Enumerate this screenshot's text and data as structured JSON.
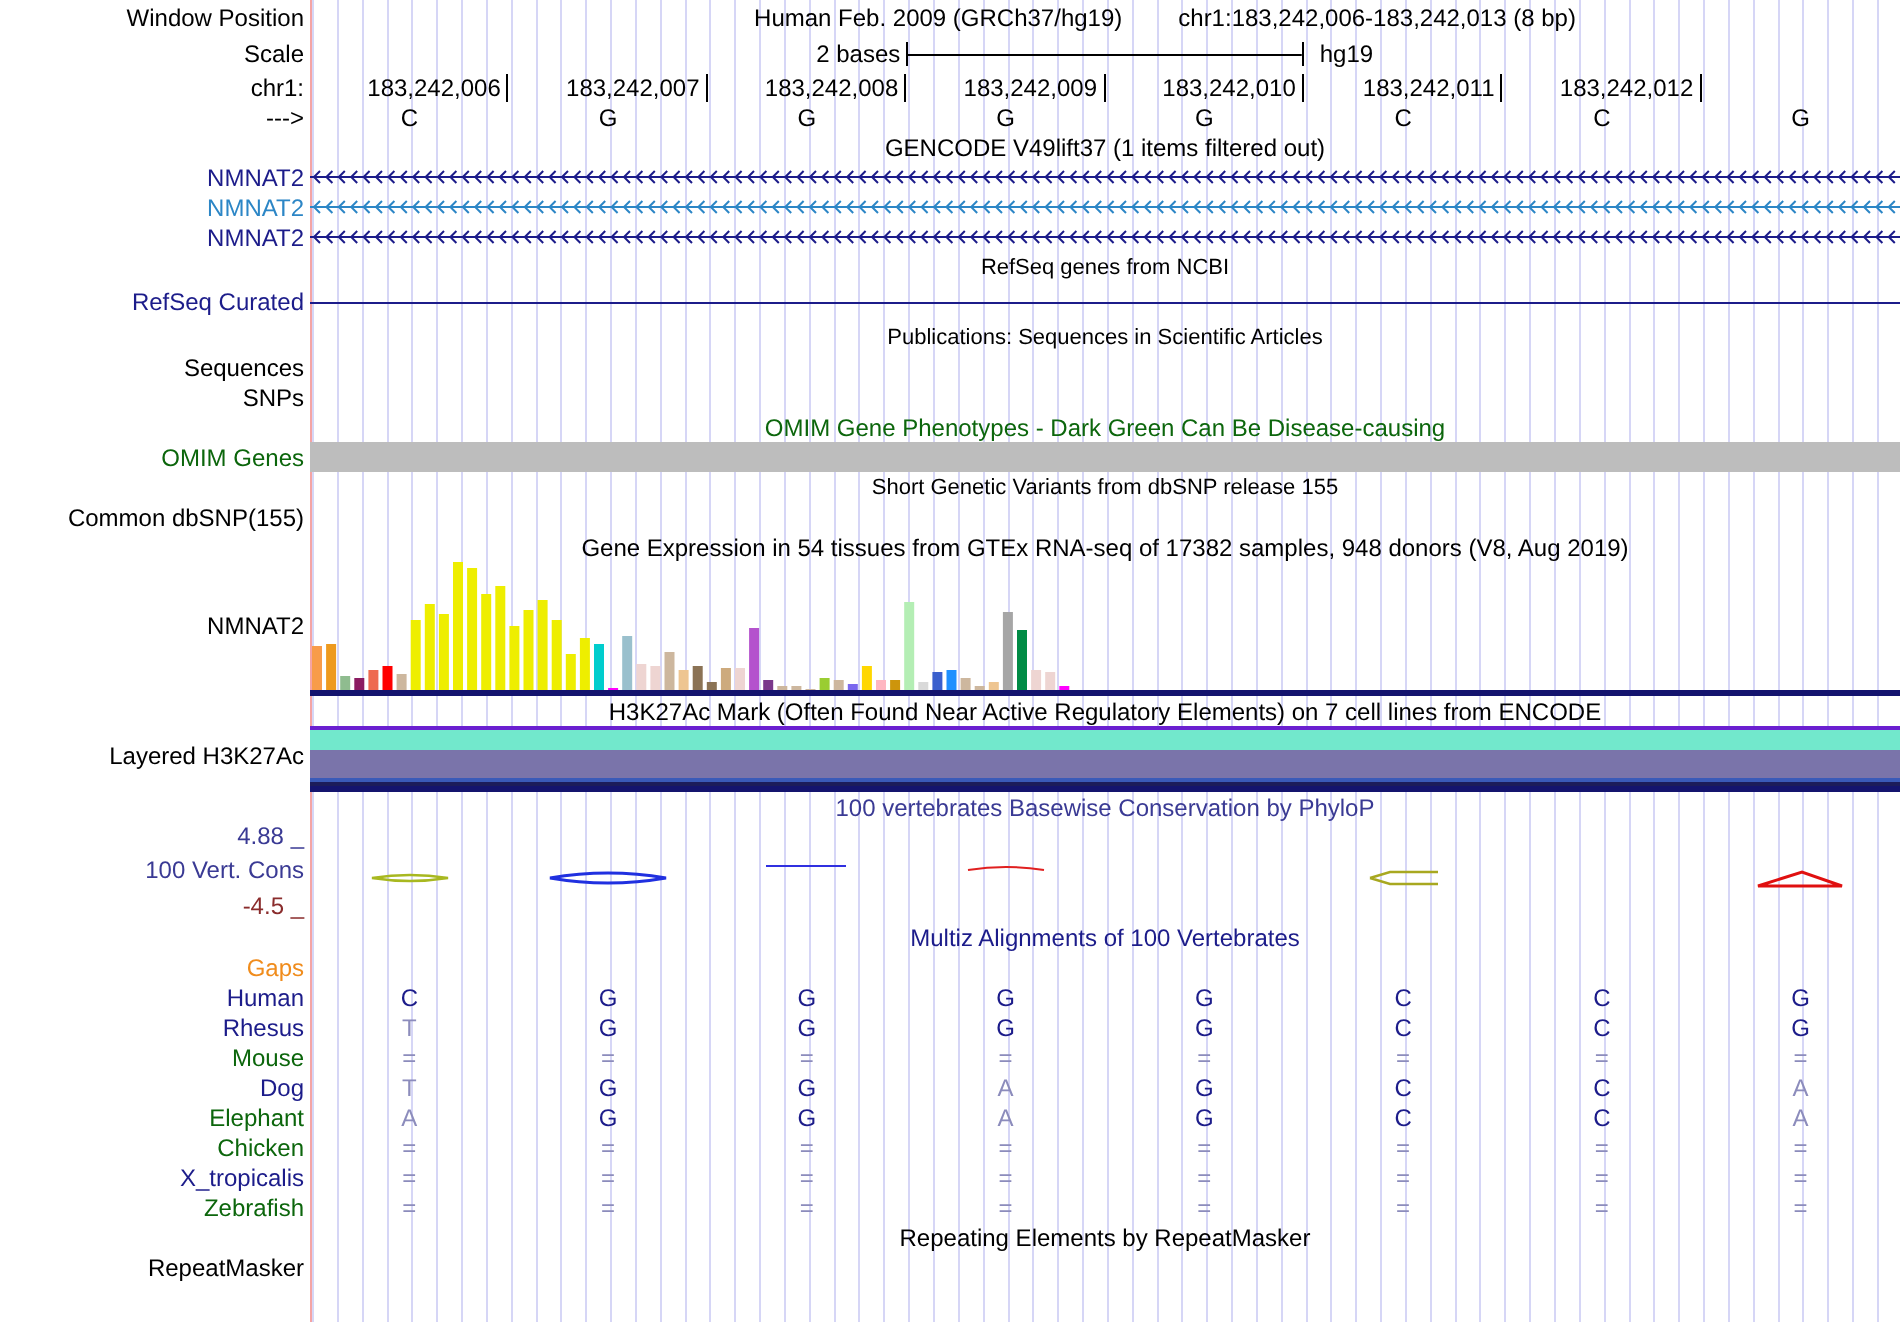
{
  "header": {
    "window_position": {
      "label": "Window Position",
      "assembly": "Human Feb. 2009 (GRCh37/hg19)",
      "range": "chr1:183,242,006-183,242,013 (8 bp)"
    },
    "scale": {
      "label": "Scale",
      "text": "2 bases",
      "assembly": "hg19"
    },
    "ruler": {
      "label": "chr1:",
      "positions": [
        "183,242,006",
        "183,242,007",
        "183,242,008",
        "183,242,009",
        "183,242,010",
        "183,242,011",
        "183,242,012"
      ]
    },
    "sequence": {
      "label": "--->",
      "bases": [
        "C",
        "G",
        "G",
        "G",
        "G",
        "C",
        "C",
        "G"
      ]
    }
  },
  "tracks": [
    {
      "kind": "transcripts",
      "title": "GENCODE V49lift37 (1 items filtered out)",
      "items": [
        {
          "label": "NMNAT2",
          "color": "#1c1c8a"
        },
        {
          "label": "NMNAT2",
          "color": "#2c86c6"
        },
        {
          "label": "NMNAT2",
          "color": "#1c1c8a"
        }
      ]
    },
    {
      "kind": "line",
      "title": "RefSeq genes from NCBI",
      "label": "RefSeq Curated",
      "color": "#1c1c8a"
    },
    {
      "kind": "empty",
      "title": "Publications: Sequences in Scientific Articles",
      "labels": [
        "Sequences",
        "SNPs"
      ]
    },
    {
      "kind": "bar",
      "title": "OMIM Gene Phenotypes - Dark Green Can Be Disease-causing",
      "label": "OMIM Genes",
      "color": "#0c660c"
    },
    {
      "kind": "empty",
      "title": "Short Genetic Variants from dbSNP release 155",
      "labels": [
        "Common dbSNP(155)"
      ]
    },
    {
      "kind": "expression",
      "title": "Gene Expression in 54 tissues from GTEx RNA-seq of 17382 samples, 948 donors (V8, Aug 2019)",
      "label": "NMNAT2"
    },
    {
      "kind": "layered",
      "title": "H3K27Ac Mark (Often Found Near Active Regulatory Elements) on 7 cell lines from ENCODE",
      "label": "Layered H3K27Ac"
    },
    {
      "kind": "conservation",
      "title": "100 vertebrates Basewise Conservation by PhyloP",
      "label": "100 Vert. Cons",
      "color": "#3a3a94",
      "max": "4.88 _",
      "min": {
        "text": "-4.5 _",
        "color": "#8a2c2c"
      }
    },
    {
      "kind": "alignment",
      "title": "Multiz Alignments of 100 Vertebrates",
      "color": "#1c1c8a",
      "gaps": {
        "label": "Gaps",
        "color": "#f08c1c"
      },
      "species": [
        {
          "name": "Human",
          "color": "#1c1c8a",
          "bases": [
            "C",
            "G",
            "G",
            "G",
            "G",
            "C",
            "C",
            "G"
          ],
          "differs": [
            false,
            false,
            false,
            false,
            false,
            false,
            false,
            false
          ]
        },
        {
          "name": "Rhesus",
          "color": "#1c1c8a",
          "bases": [
            "T",
            "G",
            "G",
            "G",
            "G",
            "C",
            "C",
            "G"
          ],
          "differs": [
            true,
            false,
            false,
            false,
            false,
            false,
            false,
            false
          ]
        },
        {
          "name": "Mouse",
          "color": "#0c660c",
          "bases": [
            "=",
            "=",
            "=",
            "=",
            "=",
            "=",
            "=",
            "="
          ],
          "differs": [
            true,
            true,
            true,
            true,
            true,
            true,
            true,
            true
          ]
        },
        {
          "name": "Dog",
          "color": "#1c1c8a",
          "bases": [
            "T",
            "G",
            "G",
            "A",
            "G",
            "C",
            "C",
            "A"
          ],
          "differs": [
            true,
            false,
            false,
            true,
            false,
            false,
            false,
            true
          ]
        },
        {
          "name": "Elephant",
          "color": "#0c660c",
          "bases": [
            "A",
            "G",
            "G",
            "A",
            "G",
            "C",
            "C",
            "A"
          ],
          "differs": [
            true,
            false,
            false,
            true,
            false,
            false,
            false,
            true
          ]
        },
        {
          "name": "Chicken",
          "color": "#0c660c",
          "bases": [
            "=",
            "=",
            "=",
            "=",
            "=",
            "=",
            "=",
            "="
          ],
          "differs": [
            true,
            true,
            true,
            true,
            true,
            true,
            true,
            true
          ]
        },
        {
          "name": "X_tropicalis",
          "color": "#1c1c8a",
          "bases": [
            "=",
            "=",
            "=",
            "=",
            "=",
            "=",
            "=",
            "="
          ],
          "differs": [
            true,
            true,
            true,
            true,
            true,
            true,
            true,
            true
          ]
        },
        {
          "name": "Zebrafish",
          "color": "#0c660c",
          "bases": [
            "=",
            "=",
            "=",
            "=",
            "=",
            "=",
            "=",
            "="
          ],
          "differs": [
            true,
            true,
            true,
            true,
            true,
            true,
            true,
            true
          ]
        }
      ]
    },
    {
      "kind": "empty",
      "title": "Repeating Elements by RepeatMasker",
      "labels": [
        "RepeatMasker"
      ]
    }
  ]
}
